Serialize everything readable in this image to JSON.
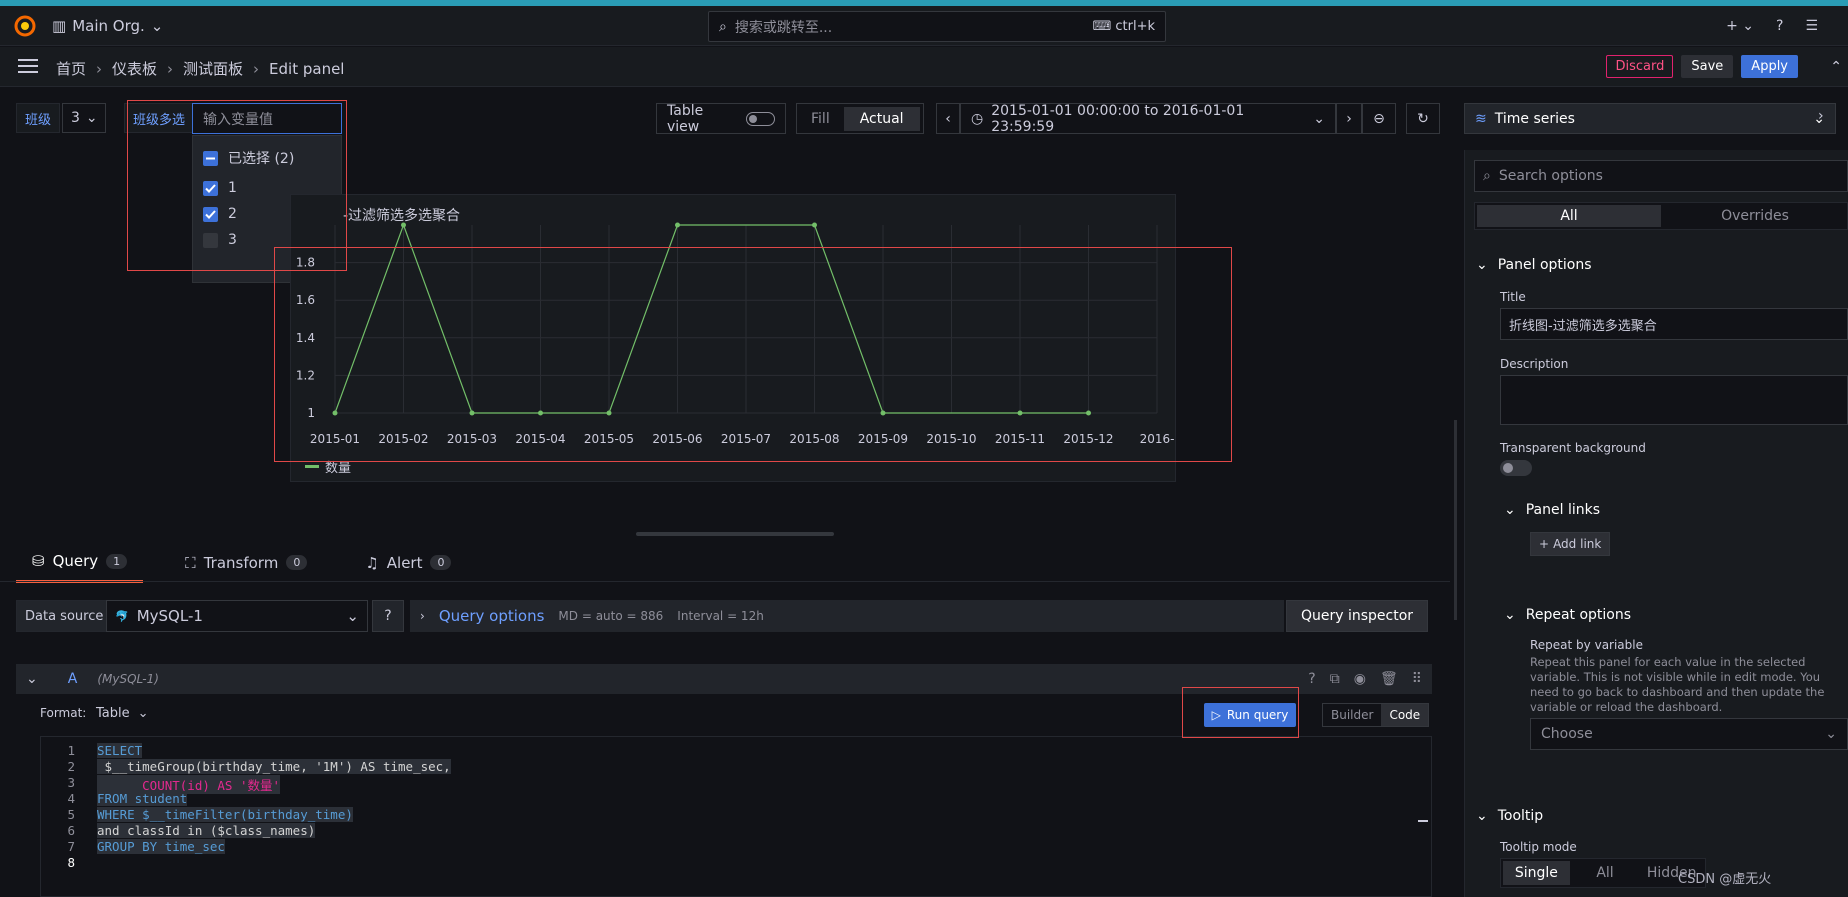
{
  "topbar": {
    "org": "Main Org.",
    "search_placeholder": "搜索或跳转至...",
    "search_shortcut": "ctrl+k"
  },
  "breadcrumb": {
    "items": [
      "首页",
      "仪表板",
      "测试面板",
      "Edit panel"
    ]
  },
  "actions": {
    "discard": "Discard",
    "save": "Save",
    "apply": "Apply"
  },
  "variables": {
    "class_label": "班级",
    "class_value": "3",
    "multi_label": "班级多选",
    "multi_placeholder": "输入变量值",
    "dropdown": {
      "selected_header": "已选择 (2)",
      "options": [
        {
          "label": "1",
          "checked": true
        },
        {
          "label": "2",
          "checked": true
        },
        {
          "label": "3",
          "checked": false
        }
      ]
    }
  },
  "toolbar": {
    "table_view": "Table view",
    "fill": "Fill",
    "actual": "Actual",
    "time_range": "2015-01-01 00:00:00 to 2016-01-01 23:59:59"
  },
  "panel": {
    "title_visible": "-过滤筛选多选聚合",
    "legend": "数量"
  },
  "chart_data": {
    "type": "line",
    "title": "折线图-过滤筛选多选聚合",
    "x": [
      "2015-01",
      "2015-02",
      "2015-03",
      "2015-04",
      "2015-05",
      "2015-06",
      "2015-07",
      "2015-08",
      "2015-09",
      "2015-10",
      "2015-11",
      "2015-12"
    ],
    "x_ticks": [
      "2015-01",
      "2015-02",
      "2015-03",
      "2015-04",
      "2015-05",
      "2015-06",
      "2015-07",
      "2015-08",
      "2015-09",
      "2015-10",
      "2015-11",
      "2015-12",
      "2016-"
    ],
    "y_ticks": [
      "1",
      "1.2",
      "1.4",
      "1.6",
      "1.8"
    ],
    "series": [
      {
        "name": "数量",
        "color": "#73bf69",
        "points": [
          [
            "2015-01",
            1
          ],
          [
            "2015-02",
            2
          ],
          [
            "2015-03",
            1
          ],
          [
            "2015-04",
            1
          ],
          [
            "2015-05",
            1
          ],
          [
            "2015-06",
            2
          ],
          [
            "2015-08",
            2
          ],
          [
            "2015-09",
            1
          ],
          [
            "2015-11",
            1
          ],
          [
            "2015-12",
            1
          ]
        ]
      }
    ],
    "ylim": [
      1,
      2
    ],
    "grid": true,
    "legend": "bottom-left"
  },
  "tabs": [
    {
      "label": "Query",
      "count": "1"
    },
    {
      "label": "Transform",
      "count": "0"
    },
    {
      "label": "Alert",
      "count": "0"
    }
  ],
  "query": {
    "ds_label": "Data source",
    "ds_value": "MySQL-1",
    "options_label": "Query options",
    "md": "MD = auto = 886",
    "interval": "Interval = 12h",
    "inspector": "Query inspector",
    "ref": "A",
    "ref_ds": "(MySQL-1)",
    "format_label": "Format:",
    "format_value": "Table",
    "run": "Run query",
    "builder": "Builder",
    "code": "Code",
    "lines": [
      "SELECT",
      " $__timeGroup(birthday_time, '1M') AS time_sec,",
      "      COUNT(id) AS '数量'",
      "FROM student",
      "WHERE $__timeFilter(birthday_time)",
      "and classId in ($class_names)",
      "GROUP BY time_sec",
      ""
    ]
  },
  "sidebar": {
    "viz": "Time series",
    "search_placeholder": "Search options",
    "all": "All",
    "overrides": "Overrides",
    "panel_options": "Panel options",
    "title_label": "Title",
    "title_value": "折线图-过滤筛选多选聚合",
    "description_label": "Description",
    "transparent_label": "Transparent background",
    "panel_links": "Panel links",
    "add_link": "Add link",
    "repeat_options": "Repeat options",
    "repeat_by": "Repeat by variable",
    "repeat_help": "Repeat this panel for each value in the selected variable. This is not visible while in edit mode. You need to go back to dashboard and then update the variable or reload the dashboard.",
    "choose": "Choose",
    "tooltip": "Tooltip",
    "tooltip_mode": "Tooltip mode",
    "modes": [
      "Single",
      "All",
      "Hidden"
    ],
    "watermark": "CSDN @虚无火"
  }
}
